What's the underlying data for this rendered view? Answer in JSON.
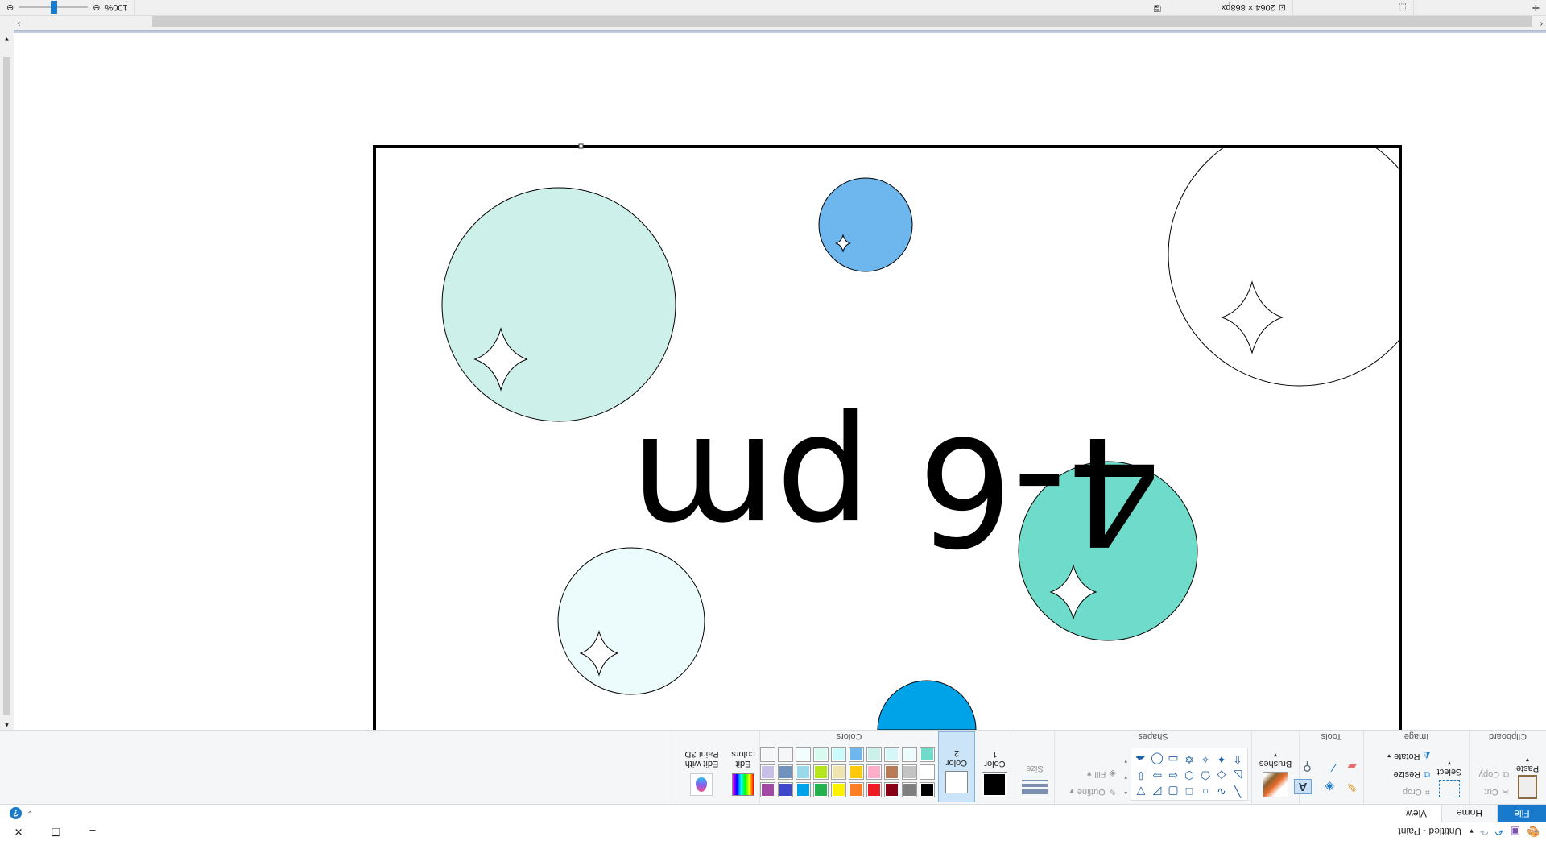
{
  "window": {
    "title": "Untitled - Paint",
    "minimize": "–",
    "restore": "❐",
    "close": "✕"
  },
  "tabs": [
    "File",
    "Home",
    "View"
  ],
  "help": "?",
  "ribbon": {
    "clipboard": {
      "label": "Clipboard",
      "paste": "Paste",
      "cut": "Cut",
      "copy": "Copy"
    },
    "image": {
      "label": "Image",
      "select": "Select",
      "crop": "Crop",
      "resize": "Resize",
      "rotate": "Rotate"
    },
    "tools": {
      "label": "Tools"
    },
    "brushes": {
      "label": "Brushes"
    },
    "shapes": {
      "label": "Shapes",
      "outline": "Outline",
      "fill": "Fill",
      "glyphs": [
        "╲",
        "∿",
        "○",
        "□",
        "▢",
        "◸",
        "▽",
        "◺",
        "◇",
        "⬠",
        "⬡",
        "⇦",
        "⇨",
        "⇩",
        "⇧",
        "✦",
        "✧",
        "✡",
        "▭",
        "◯",
        "☁"
      ]
    },
    "size": {
      "label": "Size"
    },
    "color1": {
      "label": "Color 1",
      "value": "#000000"
    },
    "color2": {
      "label": "Color 2",
      "value": "#ffffff"
    },
    "colors": {
      "label": "Colors",
      "palette": [
        "#000000",
        "#7f7f7f",
        "#880015",
        "#ed1c24",
        "#ff7f27",
        "#fff200",
        "#22b14c",
        "#00a2e8",
        "#3f48cc",
        "#a349a4",
        "#ffffff",
        "#c3c3c3",
        "#b97a57",
        "#ffaec9",
        "#ffc90e",
        "#efe4b0",
        "#b5e61d",
        "#99d9ea",
        "#7092be",
        "#c8bfe7",
        "#6fdbcb",
        "#ecfcfc",
        "#d6f7fa",
        "#cdf0eb",
        "#6db6ee",
        "#ccfbfc",
        "#d9fbef",
        "#f2fefe",
        "#f5f6f7",
        "#f5f6f7"
      ]
    },
    "edit_colors": "Edit colors",
    "paint3d": "Edit with Paint 3D"
  },
  "canvas": {
    "text": "4-6 pm",
    "circles": [
      {
        "fill": "#cdf0eb"
      },
      {
        "fill": "#6db6ee"
      },
      {
        "fill": "#ffffff"
      },
      {
        "fill": "#6fdbcb"
      },
      {
        "fill": "#ecfcfc"
      },
      {
        "fill": "#00a2e8"
      }
    ]
  },
  "status": {
    "image_size": "2064 × 868px",
    "zoom": "100%"
  }
}
